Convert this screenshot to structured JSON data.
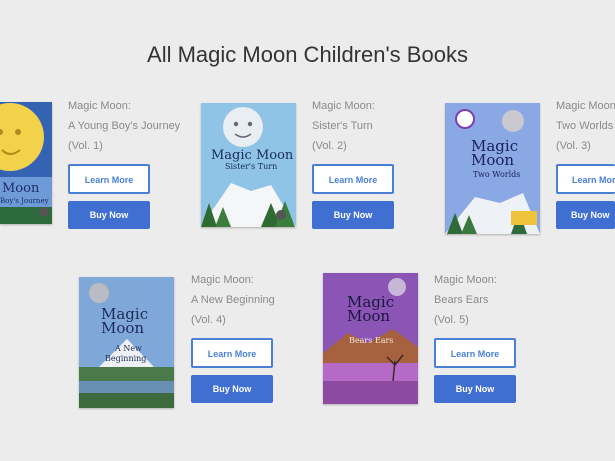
{
  "page": {
    "title": "All Magic Moon Children's Books"
  },
  "books": [
    {
      "series": "Magic Moon:",
      "subtitle": "A Young Boy's Journey",
      "volume": "(Vol. 1)",
      "learn_more": "Learn More",
      "buy_now": "Buy Now",
      "cover_title_1": "Moon",
      "cover_title_2": "Boy's Journey"
    },
    {
      "series": "Magic Moon:",
      "subtitle": "Sister's Turn",
      "volume": "(Vol. 2)",
      "learn_more": "Learn More",
      "buy_now": "Buy Now",
      "cover_title_1": "Magic Moon",
      "cover_title_2": "Sister's Turn"
    },
    {
      "series": "Magic Moon",
      "subtitle": "Two Worlds",
      "volume": "(Vol. 3)",
      "learn_more": "Learn More",
      "buy_now": "Buy Now",
      "cover_title_1": "Magic",
      "cover_title_2": "Moon",
      "cover_title_3": "Two Worlds"
    },
    {
      "series": "Magic Moon:",
      "subtitle": "A New Beginning",
      "volume": "(Vol. 4)",
      "learn_more": "Learn More",
      "buy_now": "Buy Now",
      "cover_title_1": "Magic",
      "cover_title_2": "Moon",
      "cover_title_3": "A New",
      "cover_title_4": "Beginning"
    },
    {
      "series": "Magic Moon:",
      "subtitle": "Bears Ears",
      "volume": "(Vol. 5)",
      "learn_more": "Learn More",
      "buy_now": "Buy Now",
      "cover_title_1": "Magic",
      "cover_title_2": "Moon",
      "cover_title_3": "Bears Ears"
    }
  ],
  "colors": {
    "background": "#ececec",
    "button_primary": "#3f6fd1",
    "button_outline": "#4a7fd6",
    "text_muted": "#8a8a8a"
  }
}
